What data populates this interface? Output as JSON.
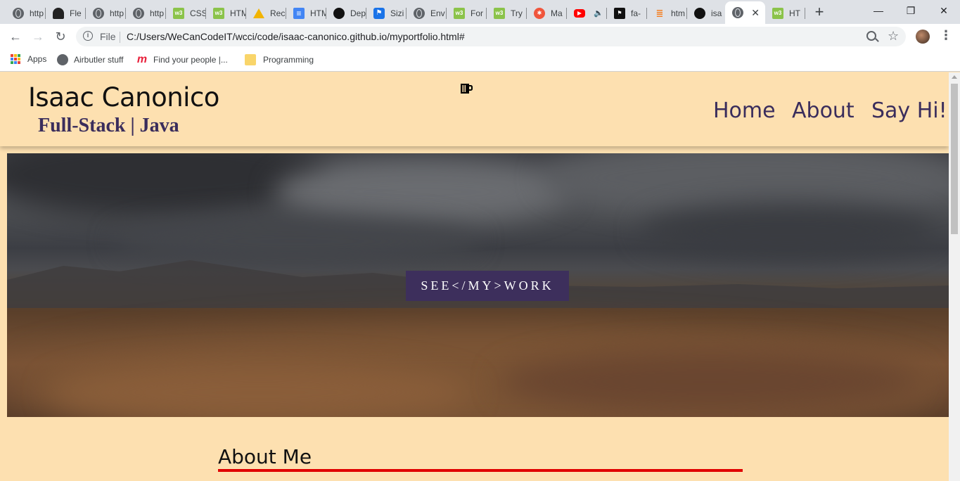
{
  "browser": {
    "tabs": [
      {
        "label": "http",
        "icon": "globe-icon"
      },
      {
        "label": "Fle",
        "icon": "hat-icon"
      },
      {
        "label": "http",
        "icon": "globe-icon"
      },
      {
        "label": "http",
        "icon": "globe-icon"
      },
      {
        "label": "CSS",
        "icon": "w3schools-icon"
      },
      {
        "label": "HTM",
        "icon": "w3schools-icon"
      },
      {
        "label": "Rec",
        "icon": "drive-icon"
      },
      {
        "label": "HTM",
        "icon": "docs-icon"
      },
      {
        "label": "Dep",
        "icon": "github-icon"
      },
      {
        "label": "Sizi",
        "icon": "flag-icon"
      },
      {
        "label": "Env",
        "icon": "globe-icon"
      },
      {
        "label": "For",
        "icon": "w3schools-icon"
      },
      {
        "label": "Try",
        "icon": "w3schools-icon"
      },
      {
        "label": "Ma",
        "icon": "asterisk-icon"
      },
      {
        "label": "",
        "icon": "youtube-icon"
      },
      {
        "label": "fa-",
        "icon": "fontawesome-icon"
      },
      {
        "label": "htm",
        "icon": "stackoverflow-icon"
      },
      {
        "label": "isa",
        "icon": "github-icon"
      },
      {
        "label": "",
        "icon": "globe-icon",
        "active": true
      },
      {
        "label": "HT",
        "icon": "w3schools-icon"
      }
    ],
    "window_controls": {
      "minimize": "—",
      "restore": "❐",
      "close": "✕"
    },
    "new_tab": "+",
    "address": {
      "scheme": "File",
      "url": "C:/Users/WeCanCodeIT/wcci/code/isaac-canonico.github.io/myportfolio.html#"
    },
    "bookmarks": [
      {
        "label": "Apps",
        "icon": "apps-grid-icon"
      },
      {
        "label": "Airbutler stuff",
        "icon": "globe-icon"
      },
      {
        "label": "Find your people |...",
        "icon": "meetup-icon"
      },
      {
        "label": "Programming",
        "icon": "folder-icon"
      }
    ]
  },
  "site": {
    "name": "Isaac Canonico",
    "tagline": "Full-Stack | Java",
    "logo_icon": "coffee-mug-icon",
    "nav": [
      "Home",
      "About",
      "Say Hi!"
    ],
    "hero_button": "SEE</MY>WORK",
    "about_title": "About Me"
  },
  "colors": {
    "page_bg": "#fde0b0",
    "accent_purple": "#3d2f5c",
    "rule_red": "#e00000"
  }
}
